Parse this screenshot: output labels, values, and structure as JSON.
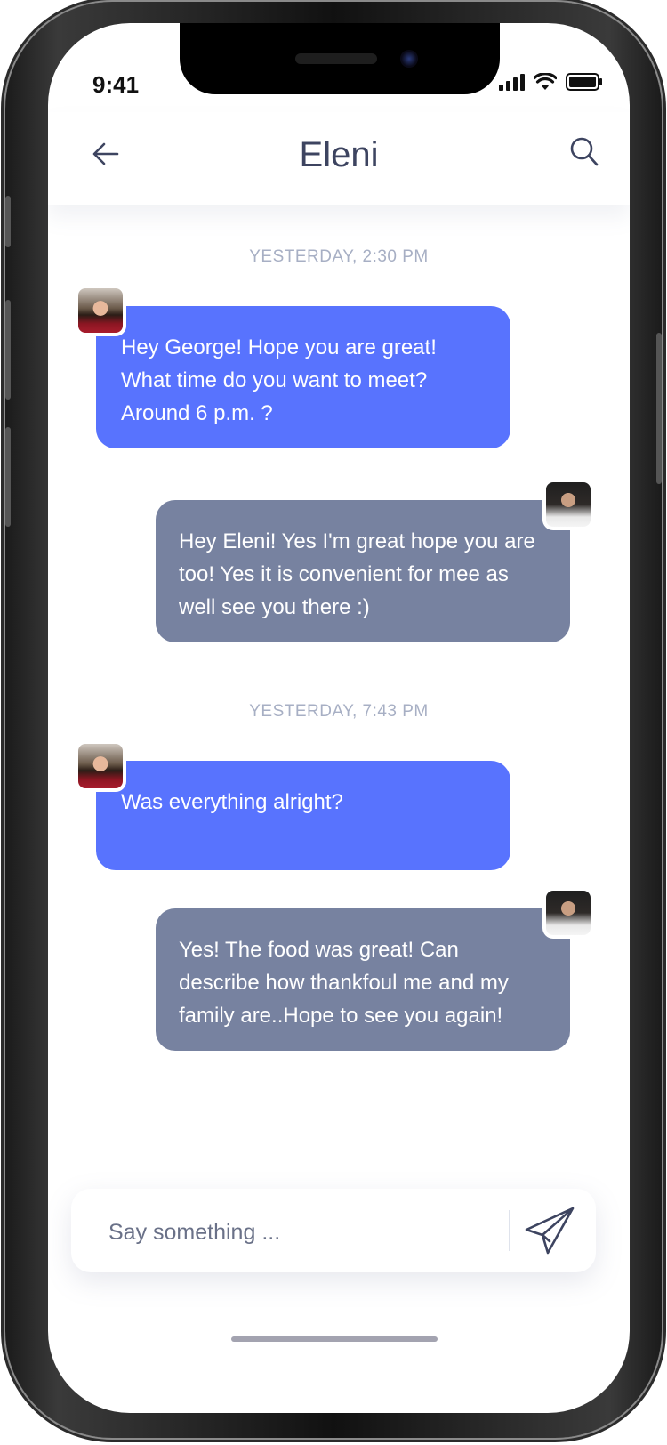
{
  "status_bar": {
    "time": "9:41"
  },
  "header": {
    "title": "Eleni"
  },
  "messages": [
    {
      "timestamp": "YESTERDAY, 2:30 PM"
    },
    {
      "from": "Eleni",
      "text": "Hey George! Hope you are great!\nWhat time do you want to meet?\nAround 6 p.m. ?"
    },
    {
      "from": "George",
      "text": "Hey Eleni! Yes I'm great hope you are\ntoo! Yes it is convenient for mee as\nwell see you there :)"
    },
    {
      "timestamp": "YESTERDAY, 7:43 PM"
    },
    {
      "from": "Eleni",
      "text": "Was everything alright?"
    },
    {
      "from": "George",
      "text": "Yes! The food was great! Can\ndescribe how thankfoul me and my\nfamily are..Hope to see you again!"
    }
  ],
  "composer": {
    "placeholder": "Say something ..."
  },
  "icons": {
    "back": "arrow-left-icon",
    "search": "search-icon",
    "send": "paper-plane-icon"
  },
  "colors": {
    "incoming_bubble": "#5873fe",
    "outgoing_bubble": "#7782a0",
    "title": "#3d4460",
    "timestamp": "#a7afc4"
  }
}
